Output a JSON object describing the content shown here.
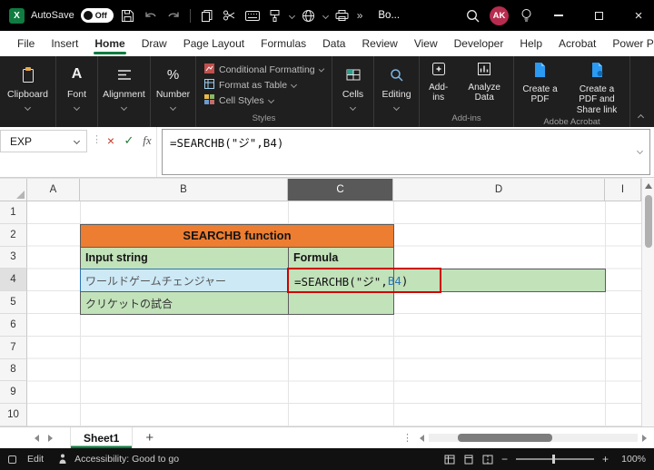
{
  "colors": {
    "excel_green": "#107C41",
    "titlebar_bg": "#000000",
    "ribbon_bg": "#1f1f1f",
    "header_orange": "#ED7D31",
    "cell_green": "#C2E2BA",
    "cell_blue": "#CDE9F6",
    "highlight_red": "#CE0000",
    "ref_blue": "#2E75B6",
    "avatar_bg": "#B72C4E"
  },
  "icons": {
    "cancel_glyph": "×",
    "confirm_glyph": "✓",
    "overflow_glyph": "»",
    "vertical_dots_glyph": "⋮",
    "app_glyph": "X"
  },
  "titlebar": {
    "autosave_label": "AutoSave",
    "autosave_state": "Off",
    "doc_name": "Bo...",
    "avatar_initials": "AK"
  },
  "tabs": {
    "items": [
      "File",
      "Insert",
      "Home",
      "Draw",
      "Page Layout",
      "Formulas",
      "Data",
      "Review",
      "View",
      "Developer",
      "Help",
      "Acrobat",
      "Power Pivot"
    ],
    "active": "Home"
  },
  "ribbon": {
    "clipboard_label": "Clipboard",
    "font_label": "Font",
    "alignment_label": "Alignment",
    "number_label": "Number",
    "styles": {
      "buttons": [
        "Conditional Formatting",
        "Format as Table",
        "Cell Styles"
      ],
      "label": "Styles"
    },
    "cells_label": "Cells",
    "editing_label": "Editing",
    "addins": {
      "buttons": [
        "Add-ins",
        "Analyze Data"
      ],
      "label": "Add-ins"
    },
    "acrobat": {
      "buttons": [
        "Create a PDF",
        "Create a PDF and Share link"
      ],
      "label": "Adobe Acrobat"
    }
  },
  "formula_bar": {
    "name_box": "EXP",
    "fx_label": "fx",
    "formula": "=SEARCHB(\"ジ\",B4)"
  },
  "grid": {
    "columns": [
      "A",
      "B",
      "C",
      "D",
      "I"
    ],
    "rows": [
      "1",
      "2",
      "3",
      "4",
      "5",
      "6",
      "7",
      "8",
      "9",
      "10"
    ],
    "table": {
      "title": "SEARCHB function",
      "col1_header": "Input string",
      "col2_header": "Formula",
      "row1_input": "ワールドゲームチェンジャー",
      "row2_input": "クリケットの試合",
      "formula_prefix": "=SEARCHB(\"ジ\",",
      "formula_ref": "B4",
      "formula_suffix": ")"
    }
  },
  "sheet_tabs": {
    "active": "Sheet1",
    "add_label": "+"
  },
  "status_bar": {
    "mode": "Edit",
    "accessibility": "Accessibility: Good to go",
    "zoom_minus": "−",
    "zoom_plus": "+",
    "zoom": "100%"
  }
}
